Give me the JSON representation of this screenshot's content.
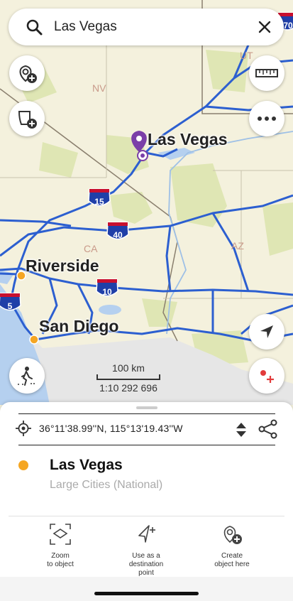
{
  "search": {
    "query": "Las Vegas"
  },
  "map": {
    "cities": [
      "Las Vegas",
      "Riverside",
      "San Diego"
    ],
    "states": [
      "NV",
      "UT",
      "CA",
      "AZ"
    ],
    "interstates": [
      "15",
      "40",
      "10",
      "5",
      "70"
    ],
    "scale_label": "100 km",
    "scale_ratio": "1:10 292 696"
  },
  "sheet": {
    "coordinates": "36°11'38.99''N, 115°13'19.43''W",
    "title": "Las Vegas",
    "subtitle": "Large Cities (National)",
    "actions": [
      {
        "label": "Zoom\nto object"
      },
      {
        "label": "Use as a\ndestination\npoint"
      },
      {
        "label": "Create\nobject here"
      }
    ]
  },
  "colors": {
    "accent": "#7b3fa8",
    "road": "#2c5fd0",
    "city_dot": "#f5a623",
    "land": "#f4f1dd",
    "park": "#dfe6b4",
    "water": "#b5d0ef"
  }
}
